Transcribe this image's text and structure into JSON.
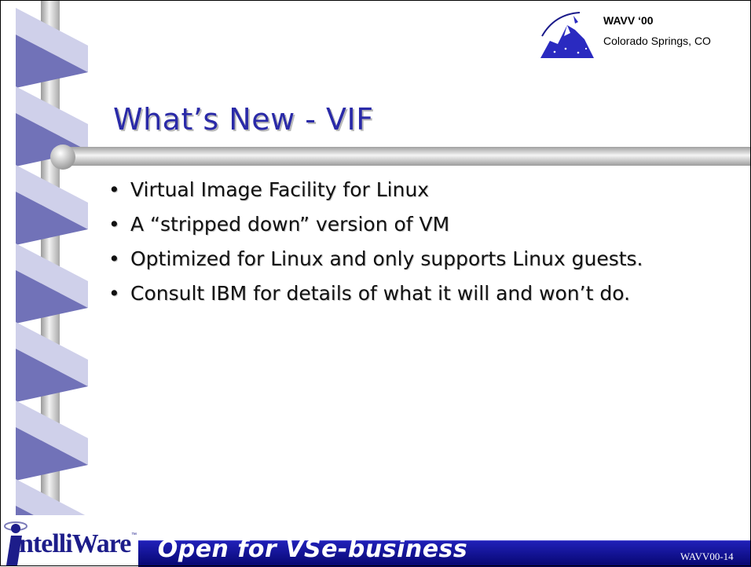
{
  "header": {
    "title": "WAVV ‘00",
    "subtitle": "Colorado Springs, CO"
  },
  "slide": {
    "title": "What’s New - VIF",
    "bullets": [
      "Virtual Image Facility for Linux",
      "A “stripped down” version of VM",
      "Optimized for Linux and only supports Linux guests.",
      "Consult IBM for details of what it will and won’t do."
    ],
    "bullet_glyph": "•"
  },
  "footer": {
    "tagline": "Open for VSe-business",
    "slide_id": "WAVV00-14"
  },
  "brand": {
    "name": "ntelliWare",
    "trademark": "™",
    "icon": "intelliware-i-logo"
  },
  "decorations": {
    "event_logo": "pikes-peak-mountain-icon",
    "ribbon": "ribbon-helix-decoration"
  },
  "colors": {
    "title": "#2a2aa8",
    "ribbon_light": "#cfd0ea",
    "ribbon_shade": "#6f70b6",
    "footer_bar": "#0e0e8a",
    "brand": "#1d1d8a"
  }
}
